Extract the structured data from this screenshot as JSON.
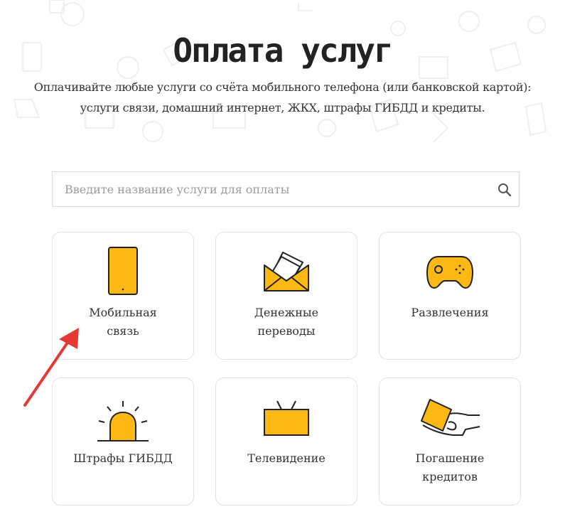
{
  "page": {
    "title": "Оплата услуг",
    "subtitle_line1": "Оплачивайте любые услуги со счёта мобильного телефона (или банковской картой):",
    "subtitle_line2": "услуги связи, домашний интернет, ЖКХ, штрафы ГИБДД и кредиты."
  },
  "search": {
    "placeholder": "Введите название услуги для оплаты",
    "value": "",
    "icon": "search-icon"
  },
  "categories": [
    {
      "label": "Мобильная\nсвязь",
      "icon": "mobile-phone-icon"
    },
    {
      "label": "Денежные\nпереводы",
      "icon": "envelope-icon"
    },
    {
      "label": "Развлечения",
      "icon": "gamepad-icon"
    },
    {
      "label": "Штрафы ГИБДД",
      "icon": "siren-icon"
    },
    {
      "label": "Телевидение",
      "icon": "tv-icon"
    },
    {
      "label": "Погашение\nкредитов",
      "icon": "card-in-hand-icon"
    }
  ],
  "colors": {
    "accent": "#FDB913",
    "outline": "#222222",
    "card_border": "#E2E2E2",
    "annotation_arrow": "#E53935"
  }
}
